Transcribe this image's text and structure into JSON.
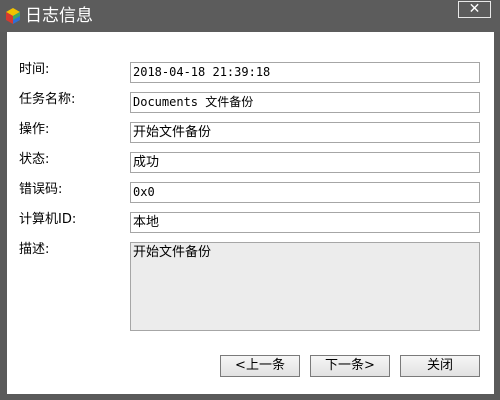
{
  "window": {
    "title": "日志信息",
    "close_glyph": "✕"
  },
  "fields": [
    {
      "label": "时间:",
      "value": "2018-04-18 21:39:18"
    },
    {
      "label": "任务名称:",
      "value": "Documents 文件备份"
    },
    {
      "label": "操作:",
      "value": "开始文件备份"
    },
    {
      "label": "状态:",
      "value": "成功"
    },
    {
      "label": "错误码:",
      "value": "0x0"
    },
    {
      "label": "计算机ID:",
      "value": "本地"
    }
  ],
  "description": {
    "label": "描述:",
    "value": "开始文件备份"
  },
  "buttons": {
    "prev": "<上一条",
    "next": "下一条>",
    "close": "关闭"
  },
  "colors": {
    "titlebar": "#5c5c5c",
    "window_bg": "#ffffff",
    "input_border": "#a6a6a6",
    "textarea_bg": "#ececec"
  },
  "icons": {
    "app": "app-icon",
    "close": "close-icon"
  }
}
